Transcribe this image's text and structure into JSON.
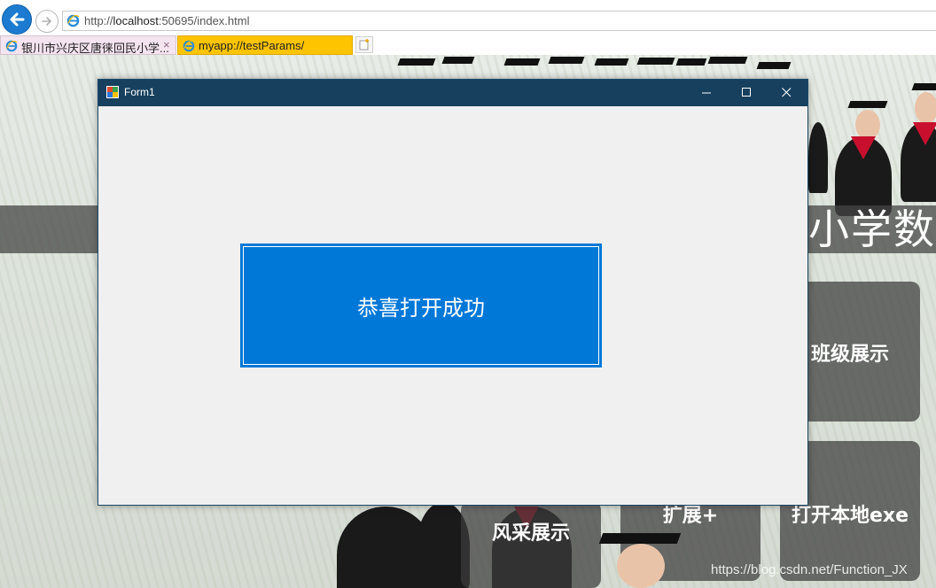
{
  "browser": {
    "url_prefix": "http://",
    "url_host": "localhost",
    "url_rest": ":50695/index.html",
    "tabs": [
      {
        "label": "银川市兴庆区唐徕回民小学...",
        "active": false
      },
      {
        "label": "myapp://testParams/",
        "active": true
      }
    ],
    "close_glyph": "×"
  },
  "page": {
    "banner_text": "小学数",
    "tiles": [
      {
        "label": "班级展示"
      },
      {
        "label": "风采展示"
      },
      {
        "label": "扩展+"
      },
      {
        "label": "打开本地exe"
      }
    ],
    "watermark": "https://blog.csdn.net/Function_JX"
  },
  "window": {
    "title": "Form1",
    "button_label": "恭喜打开成功"
  },
  "colors": {
    "titlebar": "#17405e",
    "button": "#0078d7",
    "active_tab": "#ffc400",
    "back_button": "#1c7bd0"
  }
}
